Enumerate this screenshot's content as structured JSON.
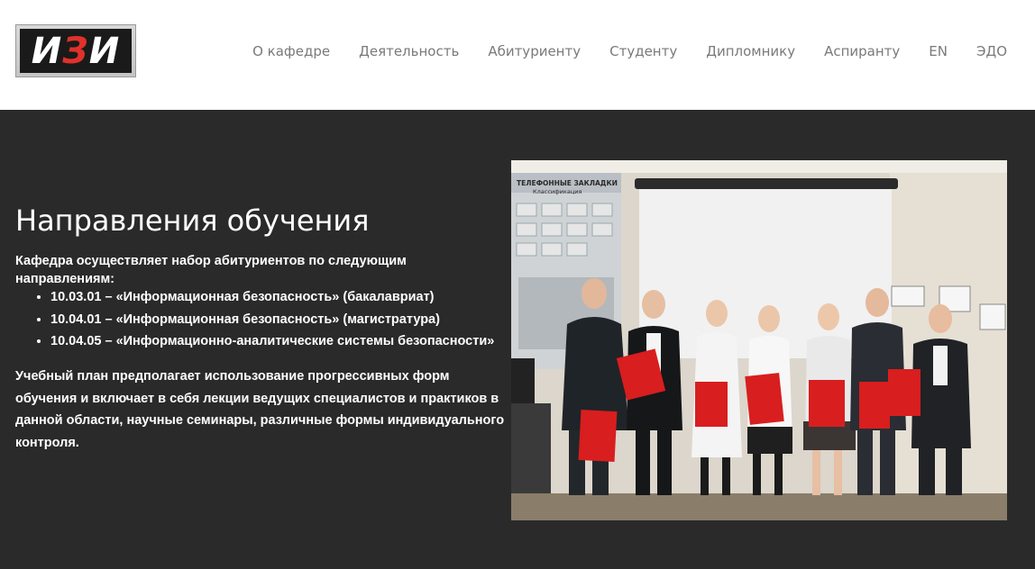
{
  "header": {
    "logo_text_left": "И",
    "logo_text_mid": "З",
    "logo_text_right": "И",
    "nav": [
      {
        "label": "О кафедре"
      },
      {
        "label": "Деятельность"
      },
      {
        "label": "Абитуриенту"
      },
      {
        "label": "Студенту"
      },
      {
        "label": "Дипломнику"
      },
      {
        "label": "Аспиранту"
      },
      {
        "label": "EN"
      },
      {
        "label": "ЭДО"
      }
    ]
  },
  "main": {
    "title": "Направления обучения",
    "intro": "Кафедра осуществляет набор абитуриентов по следующим направлениям:",
    "directions": [
      "10.03.01 – «Информационная безопасность» (бакалавриат)",
      "10.04.01 – «Информационная безопасность» (магистратура)",
      "10.04.05 – «Информационно-аналитические системы безопасности»"
    ],
    "plan": "Учебный план предполагает использование прогрессивных форм обучения и включает в себя лекции ведущих специалистов и практиков в данной области, научные семинары, различные формы индивидуального контроля.",
    "photo": {
      "board_title": "ТЕЛЕФОННЫЕ ЗАКЛАДКИ",
      "board_subtitle": "Классификация"
    }
  },
  "colors": {
    "header_bg": "#ffffff",
    "content_bg": "#2a2a2a",
    "nav_text": "#7a7a7a",
    "logo_accent": "#e0312b",
    "folder_red": "#d81e1e"
  }
}
